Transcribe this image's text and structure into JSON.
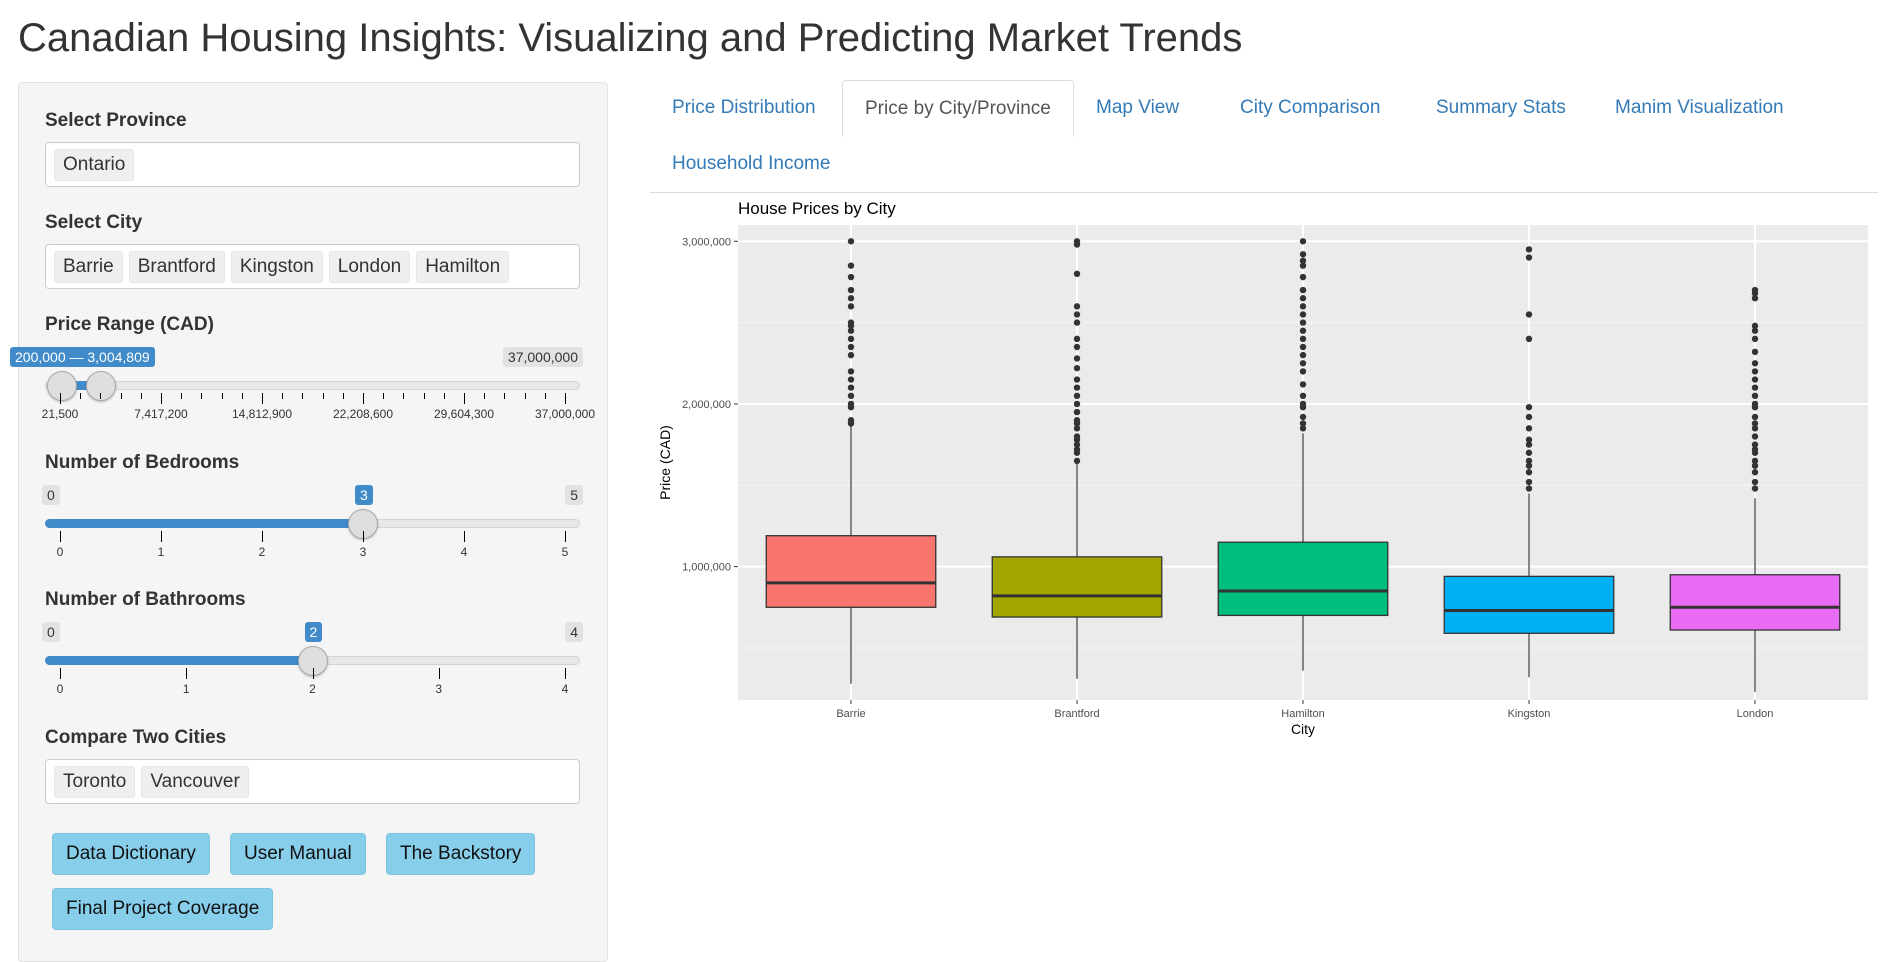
{
  "app": {
    "title": "Canadian Housing Insights: Visualizing and Predicting Market Trends"
  },
  "sidebar": {
    "province": {
      "label": "Select Province",
      "values": [
        "Ontario"
      ]
    },
    "city": {
      "label": "Select City",
      "values": [
        "Barrie",
        "Brantford",
        "Kingston",
        "London",
        "Hamilton"
      ]
    },
    "price_range": {
      "label": "Price Range (CAD)",
      "min": 21500,
      "max": 37000000,
      "selected_from": 200000,
      "selected_to": 3004809,
      "selected_label": "200,000 — 3,004,809",
      "max_label": "37,000,000",
      "tick_labels": [
        "21,500",
        "7,417,200",
        "14,812,900",
        "22,208,600",
        "29,604,300",
        "37,000,000"
      ]
    },
    "bedrooms": {
      "label": "Number of Bedrooms",
      "min": 0,
      "max": 5,
      "value": 3,
      "min_label": "0",
      "max_label": "5",
      "value_label": "3",
      "tick_labels": [
        "0",
        "1",
        "2",
        "3",
        "4",
        "5"
      ]
    },
    "bathrooms": {
      "label": "Number of Bathrooms",
      "min": 0,
      "max": 4,
      "value": 2,
      "min_label": "0",
      "max_label": "4",
      "value_label": "2",
      "tick_labels": [
        "0",
        "1",
        "2",
        "3",
        "4"
      ]
    },
    "compare": {
      "label": "Compare Two Cities",
      "values": [
        "Toronto",
        "Vancouver"
      ]
    },
    "buttons": [
      "Data Dictionary",
      "User Manual",
      "The Backstory",
      "Final Project Coverage"
    ],
    "button_color": "#87ceeb"
  },
  "tabs": {
    "items": [
      "Price Distribution",
      "Price by City/Province",
      "Map View",
      "City Comparison",
      "Summary Stats",
      "Manim Visualization",
      "Household Income"
    ],
    "active": "Price by City/Province"
  },
  "chart_data": {
    "type": "boxplot",
    "title": "House Prices by City",
    "xlabel": "City",
    "ylabel": "Price (CAD)",
    "ylim": [
      180000,
      3100000
    ],
    "y_ticks": [
      1000000,
      2000000,
      3000000
    ],
    "y_tick_labels": [
      "1,000,000",
      "2,000,000",
      "3,000,000"
    ],
    "grid": true,
    "categories": [
      "Barrie",
      "Brantford",
      "Hamilton",
      "Kingston",
      "London"
    ],
    "colors": [
      "#f8766d",
      "#a3a500",
      "#00bf7d",
      "#00b0f6",
      "#e76bf3"
    ],
    "boxes": [
      {
        "min": 280000,
        "q1": 750000,
        "median": 900000,
        "q3": 1190000,
        "max": 1870000,
        "outliers": [
          1880000,
          1900000,
          1980000,
          2000000,
          2050000,
          2100000,
          2150000,
          2200000,
          2300000,
          2350000,
          2400000,
          2450000,
          2480000,
          2500000,
          2600000,
          2650000,
          2700000,
          2780000,
          2850000,
          3000000
        ]
      },
      {
        "min": 310000,
        "q1": 690000,
        "median": 820000,
        "q3": 1060000,
        "max": 1640000,
        "outliers": [
          1650000,
          1700000,
          1720000,
          1750000,
          1780000,
          1800000,
          1850000,
          1880000,
          1900000,
          1950000,
          2000000,
          2050000,
          2100000,
          2150000,
          2220000,
          2280000,
          2350000,
          2400000,
          2500000,
          2550000,
          2600000,
          2800000,
          2980000,
          3000000
        ]
      },
      {
        "min": 360000,
        "q1": 700000,
        "median": 850000,
        "q3": 1150000,
        "max": 1820000,
        "outliers": [
          1850000,
          1880000,
          1920000,
          1980000,
          2000000,
          2050000,
          2120000,
          2200000,
          2250000,
          2300000,
          2350000,
          2400000,
          2450000,
          2500000,
          2550000,
          2600000,
          2650000,
          2700000,
          2780000,
          2850000,
          2880000,
          2920000,
          3000000
        ]
      },
      {
        "min": 320000,
        "q1": 590000,
        "median": 730000,
        "q3": 940000,
        "max": 1450000,
        "outliers": [
          1480000,
          1520000,
          1580000,
          1620000,
          1650000,
          1700000,
          1750000,
          1780000,
          1850000,
          1920000,
          1980000,
          2400000,
          2550000,
          2900000,
          2950000
        ]
      },
      {
        "min": 230000,
        "q1": 610000,
        "median": 750000,
        "q3": 950000,
        "max": 1420000,
        "outliers": [
          1480000,
          1520000,
          1580000,
          1620000,
          1650000,
          1700000,
          1720000,
          1750000,
          1800000,
          1850000,
          1880000,
          1920000,
          1980000,
          2000000,
          2050000,
          2100000,
          2150000,
          2200000,
          2250000,
          2320000,
          2400000,
          2450000,
          2480000,
          2650000,
          2680000,
          2700000
        ]
      }
    ]
  }
}
